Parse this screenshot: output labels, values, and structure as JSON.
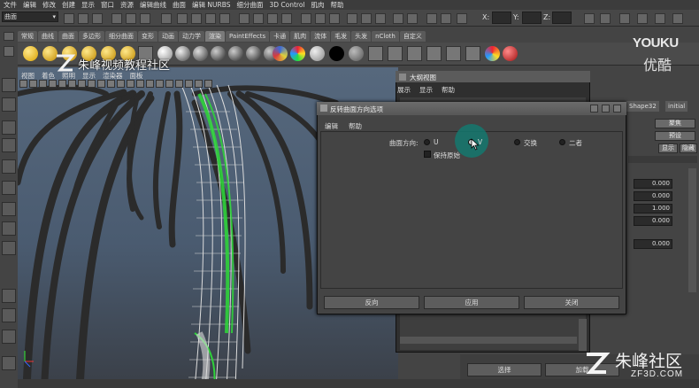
{
  "menubar": [
    "文件",
    "编辑",
    "修改",
    "创建",
    "显示",
    "窗口",
    "资源",
    "编辑曲线",
    "曲面",
    "编辑 NURBS",
    "细分曲面",
    "3D Control",
    "肌肉",
    "帮助"
  ],
  "status": {
    "mode": "曲面",
    "x_label": "X:",
    "y_label": "Y:",
    "z_label": "Z:"
  },
  "shelf_tabs": [
    "常规",
    "曲线",
    "曲面",
    "多边形",
    "细分曲面",
    "变形",
    "动画",
    "动力学",
    "渲染",
    "PaintEffects",
    "卡通",
    "肌肉",
    "流体",
    "毛发",
    "头发",
    "nCloth",
    "自定义"
  ],
  "shelf_active": "渲染",
  "viewport_menu": [
    "视图",
    "着色",
    "照明",
    "显示",
    "渲染器",
    "面板"
  ],
  "outliner": {
    "title": "大纲视图",
    "menu": [
      "展示",
      "显示",
      "帮助"
    ]
  },
  "attr": {
    "tab_labels": [
      "Shape32",
      "initial"
    ],
    "btn_focus": "聚焦",
    "btn_preset": "预设",
    "btn_show": "显示",
    "btn_hide": "隐藏",
    "fields": [
      "0.000",
      "0.000",
      "1.000",
      "0.000",
      "0.000"
    ]
  },
  "dialog": {
    "title": "反转曲面方向选项",
    "menu": [
      "编辑",
      "帮助"
    ],
    "label_direction": "曲面方向:",
    "opt_u": "U",
    "opt_v": "V",
    "opt_swap": "交换",
    "opt_both": "二者",
    "keep_original": "保持原始",
    "btn_reverse": "反向",
    "btn_apply": "应用",
    "btn_close": "关闭"
  },
  "bottom": {
    "select": "选择",
    "add": "加载"
  },
  "watermarks": {
    "top_left": "朱峰视频教程社区",
    "youku": "YOUKU",
    "youku_cn": "优酷",
    "zf": "朱峰社区",
    "zf_url": "ZF3D.COM"
  },
  "colors": {
    "accent_green": "#2fd23a",
    "cursor_halo": "#14786e"
  }
}
